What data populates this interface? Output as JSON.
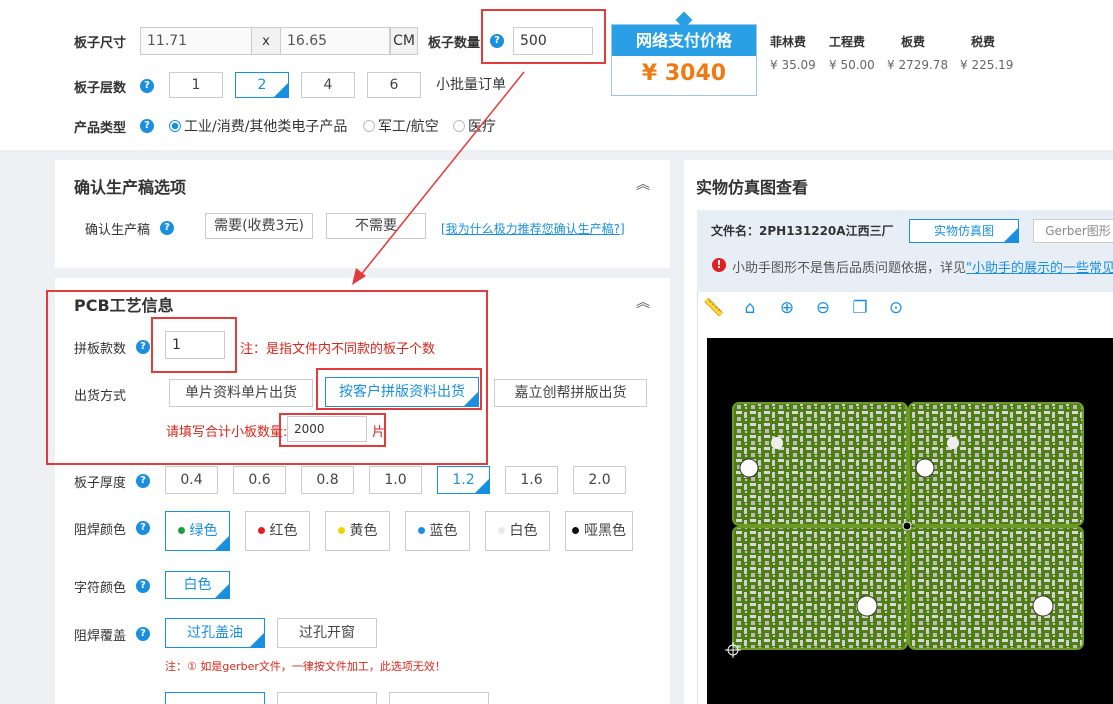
{
  "top": {
    "size_label": "板子尺寸",
    "size_w": "11.71",
    "size_x": "x",
    "size_h": "16.65",
    "size_unit": "CM",
    "qty_label": "板子数量",
    "qty_value": "500",
    "layers_label": "板子层数",
    "layers": [
      "1",
      "2",
      "4",
      "6"
    ],
    "layers_selected": "2",
    "small_batch": "小批量订单",
    "product_label": "产品类型",
    "product_options": [
      "工业/消费/其他类电子产品",
      "军工/航空",
      "医疗"
    ],
    "price_title": "网络支付价格",
    "price_value": "¥ 3040",
    "fees_headers": [
      "菲林费",
      "工程费",
      "板费",
      "税费"
    ],
    "fees_values": [
      "¥ 35.09",
      "¥ 50.00",
      "¥ 2729.78",
      "¥ 225.19"
    ]
  },
  "confirm": {
    "title": "确认生产稿选项",
    "label": "确认生产稿",
    "opt1": "需要(收费3元)",
    "opt2": "不需要",
    "link": "[我为什么极力推荐您确认生产稿?]"
  },
  "pcb": {
    "title": "PCB工艺信息",
    "panel_label": "拼板款数",
    "panel_value": "1",
    "panel_note": "注：是指文件内不同款的板子个数",
    "ship_label": "出货方式",
    "ship_options": [
      "单片资料单片出货",
      "按客户拼版资料出货",
      "嘉立创帮拼版出货"
    ],
    "ship_qty_note": "请填写合计小板数量:",
    "ship_qty_value": "2000",
    "ship_qty_unit": "片",
    "thick_label": "板子厚度",
    "thick_options": [
      "0.4",
      "0.6",
      "0.8",
      "1.0",
      "1.2",
      "1.6",
      "2.0"
    ],
    "mask_label": "阻焊颜色",
    "mask_options": [
      "绿色",
      "红色",
      "黄色",
      "蓝色",
      "白色",
      "哑黑色"
    ],
    "mask_colors": [
      "#1e9e3e",
      "#e02020",
      "#f2d400",
      "#1a8fe0",
      "#e8e8f0",
      "#111111"
    ],
    "silk_label": "字符颜色",
    "silk_value": "白色",
    "cover_label": "阻焊覆盖",
    "cover_options": [
      "过孔盖油",
      "过孔开窗"
    ],
    "cover_note": "注：① 如是gerber文件，一律按文件加工，此选项无效！"
  },
  "preview": {
    "title": "实物仿真图查看",
    "file_label": "文件名：2PH131220A江西三厂",
    "tab1": "实物仿真图",
    "tab2": "Gerber图形",
    "warning": "小助手图形不是售后品质问题依据，详见",
    "warning_link": "\"小助手的展示的一些常见"
  }
}
